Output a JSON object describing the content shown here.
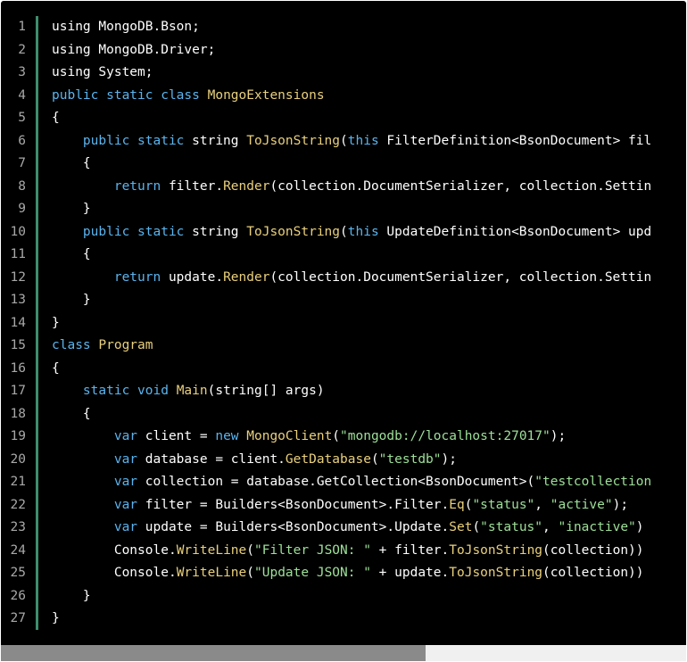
{
  "colors": {
    "background": "#000000",
    "keyword": "#5ab4ee",
    "type": "#e9d07c",
    "string": "#9de098",
    "line_number": "#a8a8a8",
    "gutter_bar": "#3e8e6e"
  },
  "scroll": {
    "thumb_fraction": 0.62
  },
  "lines": [
    {
      "n": "1",
      "tokens": [
        {
          "t": "using MongoDB.Bson;",
          "c": "pl"
        }
      ]
    },
    {
      "n": "2",
      "tokens": [
        {
          "t": "using MongoDB.Driver;",
          "c": "pl"
        }
      ]
    },
    {
      "n": "3",
      "tokens": [
        {
          "t": "using System;",
          "c": "pl"
        }
      ]
    },
    {
      "n": "4",
      "tokens": [
        {
          "t": "public static class ",
          "c": "kw"
        },
        {
          "t": "MongoExtensions",
          "c": "ty"
        }
      ]
    },
    {
      "n": "5",
      "tokens": [
        {
          "t": "{",
          "c": "pl"
        }
      ]
    },
    {
      "n": "6",
      "tokens": [
        {
          "t": "    ",
          "c": "pl"
        },
        {
          "t": "public static ",
          "c": "kw"
        },
        {
          "t": "string ",
          "c": "pl"
        },
        {
          "t": "ToJsonString",
          "c": "fn"
        },
        {
          "t": "(",
          "c": "pl"
        },
        {
          "t": "this ",
          "c": "kw"
        },
        {
          "t": "FilterDefinition<BsonDocument> fil",
          "c": "pl"
        }
      ]
    },
    {
      "n": "7",
      "tokens": [
        {
          "t": "    {",
          "c": "pl"
        }
      ]
    },
    {
      "n": "8",
      "tokens": [
        {
          "t": "        ",
          "c": "pl"
        },
        {
          "t": "return ",
          "c": "kw"
        },
        {
          "t": "filter.",
          "c": "pl"
        },
        {
          "t": "Render",
          "c": "fn"
        },
        {
          "t": "(collection.DocumentSerializer, collection.Settin",
          "c": "pl"
        }
      ]
    },
    {
      "n": "9",
      "tokens": [
        {
          "t": "    }",
          "c": "pl"
        }
      ]
    },
    {
      "n": "10",
      "tokens": [
        {
          "t": "    ",
          "c": "pl"
        },
        {
          "t": "public static ",
          "c": "kw"
        },
        {
          "t": "string ",
          "c": "pl"
        },
        {
          "t": "ToJsonString",
          "c": "fn"
        },
        {
          "t": "(",
          "c": "pl"
        },
        {
          "t": "this ",
          "c": "kw"
        },
        {
          "t": "UpdateDefinition<BsonDocument> upd",
          "c": "pl"
        }
      ]
    },
    {
      "n": "11",
      "tokens": [
        {
          "t": "    {",
          "c": "pl"
        }
      ]
    },
    {
      "n": "12",
      "tokens": [
        {
          "t": "        ",
          "c": "pl"
        },
        {
          "t": "return ",
          "c": "kw"
        },
        {
          "t": "update.",
          "c": "pl"
        },
        {
          "t": "Render",
          "c": "fn"
        },
        {
          "t": "(collection.DocumentSerializer, collection.Settin",
          "c": "pl"
        }
      ]
    },
    {
      "n": "13",
      "tokens": [
        {
          "t": "    }",
          "c": "pl"
        }
      ]
    },
    {
      "n": "14",
      "tokens": [
        {
          "t": "}",
          "c": "pl"
        }
      ]
    },
    {
      "n": "15",
      "tokens": [
        {
          "t": "class ",
          "c": "kw"
        },
        {
          "t": "Program",
          "c": "ty"
        }
      ]
    },
    {
      "n": "16",
      "tokens": [
        {
          "t": "{",
          "c": "pl"
        }
      ]
    },
    {
      "n": "17",
      "tokens": [
        {
          "t": "    ",
          "c": "pl"
        },
        {
          "t": "static void ",
          "c": "kw"
        },
        {
          "t": "Main",
          "c": "fn"
        },
        {
          "t": "(string[] args)",
          "c": "pl"
        }
      ]
    },
    {
      "n": "18",
      "tokens": [
        {
          "t": "    {",
          "c": "pl"
        }
      ]
    },
    {
      "n": "19",
      "tokens": [
        {
          "t": "        ",
          "c": "pl"
        },
        {
          "t": "var ",
          "c": "kw"
        },
        {
          "t": "client = ",
          "c": "pl"
        },
        {
          "t": "new ",
          "c": "kw"
        },
        {
          "t": "MongoClient",
          "c": "fn"
        },
        {
          "t": "(",
          "c": "pl"
        },
        {
          "t": "\"mongodb://localhost:27017\"",
          "c": "st"
        },
        {
          "t": ");",
          "c": "pl"
        }
      ]
    },
    {
      "n": "20",
      "tokens": [
        {
          "t": "        ",
          "c": "pl"
        },
        {
          "t": "var ",
          "c": "kw"
        },
        {
          "t": "database = client.",
          "c": "pl"
        },
        {
          "t": "GetDatabase",
          "c": "fn"
        },
        {
          "t": "(",
          "c": "pl"
        },
        {
          "t": "\"testdb\"",
          "c": "st"
        },
        {
          "t": ");",
          "c": "pl"
        }
      ]
    },
    {
      "n": "21",
      "tokens": [
        {
          "t": "        ",
          "c": "pl"
        },
        {
          "t": "var ",
          "c": "kw"
        },
        {
          "t": "collection = database.GetCollection<BsonDocument>(",
          "c": "pl"
        },
        {
          "t": "\"testcollection",
          "c": "st"
        }
      ]
    },
    {
      "n": "22",
      "tokens": [
        {
          "t": "        ",
          "c": "pl"
        },
        {
          "t": "var ",
          "c": "kw"
        },
        {
          "t": "filter = Builders<BsonDocument>.Filter.",
          "c": "pl"
        },
        {
          "t": "Eq",
          "c": "fn"
        },
        {
          "t": "(",
          "c": "pl"
        },
        {
          "t": "\"status\"",
          "c": "st"
        },
        {
          "t": ", ",
          "c": "pl"
        },
        {
          "t": "\"active\"",
          "c": "st"
        },
        {
          "t": ");",
          "c": "pl"
        }
      ]
    },
    {
      "n": "23",
      "tokens": [
        {
          "t": "        ",
          "c": "pl"
        },
        {
          "t": "var ",
          "c": "kw"
        },
        {
          "t": "update = Builders<BsonDocument>.Update.",
          "c": "pl"
        },
        {
          "t": "Set",
          "c": "fn"
        },
        {
          "t": "(",
          "c": "pl"
        },
        {
          "t": "\"status\"",
          "c": "st"
        },
        {
          "t": ", ",
          "c": "pl"
        },
        {
          "t": "\"inactive\"",
          "c": "st"
        },
        {
          "t": ")",
          "c": "pl"
        }
      ]
    },
    {
      "n": "24",
      "tokens": [
        {
          "t": "        Console.",
          "c": "pl"
        },
        {
          "t": "WriteLine",
          "c": "fn"
        },
        {
          "t": "(",
          "c": "pl"
        },
        {
          "t": "\"Filter JSON: \"",
          "c": "st"
        },
        {
          "t": " + filter.",
          "c": "pl"
        },
        {
          "t": "ToJsonString",
          "c": "fn"
        },
        {
          "t": "(collection))",
          "c": "pl"
        }
      ]
    },
    {
      "n": "25",
      "tokens": [
        {
          "t": "        Console.",
          "c": "pl"
        },
        {
          "t": "WriteLine",
          "c": "fn"
        },
        {
          "t": "(",
          "c": "pl"
        },
        {
          "t": "\"Update JSON: \"",
          "c": "st"
        },
        {
          "t": " + update.",
          "c": "pl"
        },
        {
          "t": "ToJsonString",
          "c": "fn"
        },
        {
          "t": "(collection))",
          "c": "pl"
        }
      ]
    },
    {
      "n": "26",
      "tokens": [
        {
          "t": "    }",
          "c": "pl"
        }
      ]
    },
    {
      "n": "27",
      "tokens": [
        {
          "t": "}",
          "c": "pl"
        }
      ]
    }
  ]
}
